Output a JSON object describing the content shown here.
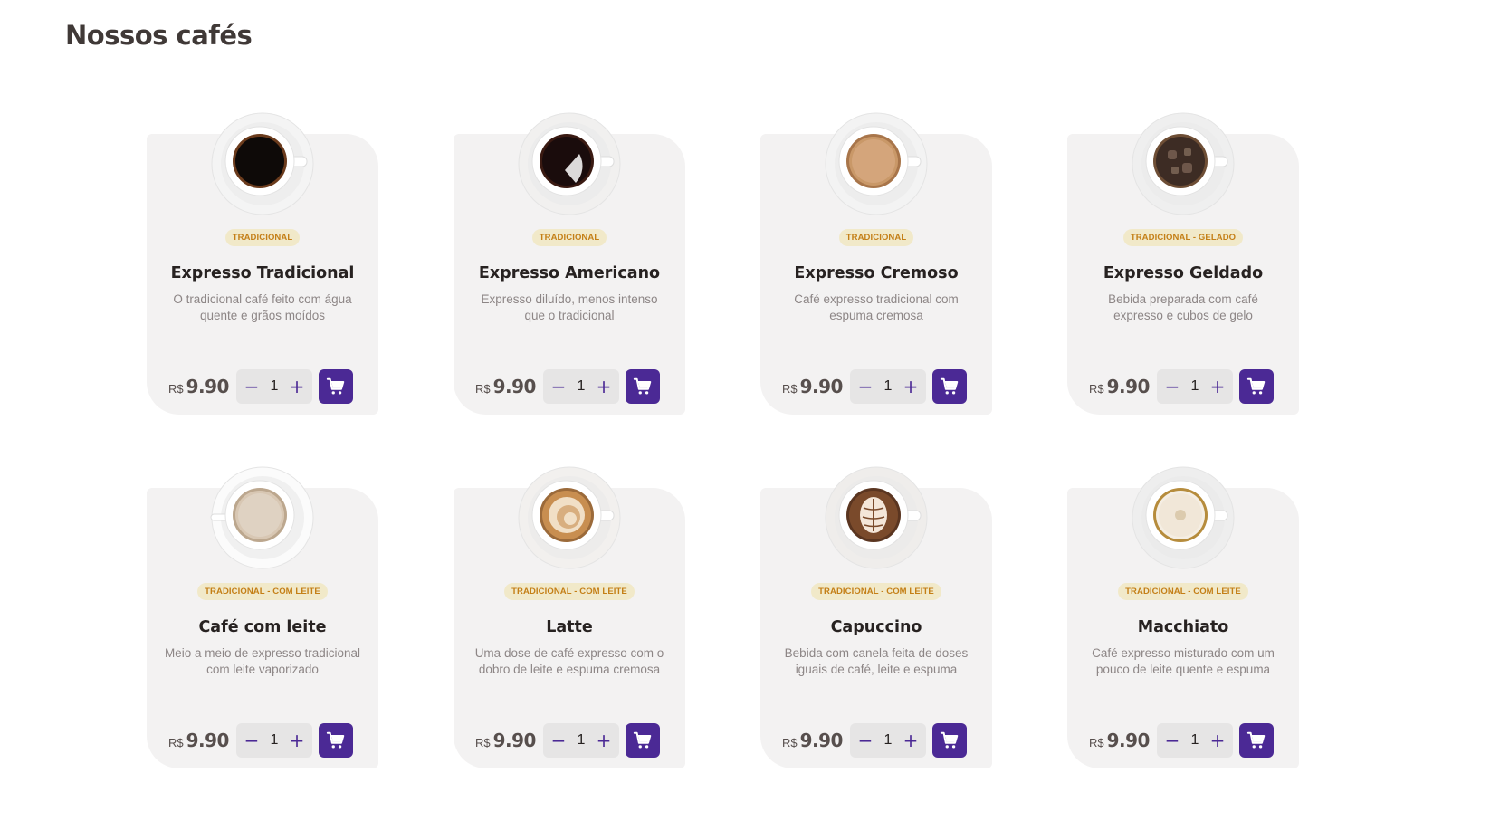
{
  "section": {
    "title": "Nossos cafés"
  },
  "colors": {
    "accent": "#4b2995",
    "tag_bg": "#f1e9c9",
    "tag_text": "#c47f17",
    "card_bg": "#f3f2f2"
  },
  "icons": {
    "cart": "shopping-cart-icon",
    "minus": "minus-icon",
    "plus": "plus-icon"
  },
  "products": [
    {
      "tag": "TRADICIONAL",
      "name": "Expresso Tradicional",
      "description": "O tradicional café feito com água quente e grãos moídos",
      "currency": "R$",
      "price": "9.90",
      "quantity": "1",
      "cup_style": "espresso"
    },
    {
      "tag": "TRADICIONAL",
      "name": "Expresso Americano",
      "description": "Expresso diluído, menos intenso que o tradicional",
      "currency": "R$",
      "price": "9.90",
      "quantity": "1",
      "cup_style": "americano"
    },
    {
      "tag": "TRADICIONAL",
      "name": "Expresso Cremoso",
      "description": "Café expresso tradicional com espuma cremosa",
      "currency": "R$",
      "price": "9.90",
      "quantity": "1",
      "cup_style": "cremoso"
    },
    {
      "tag": "TRADICIONAL - GELADO",
      "name": "Expresso Geldado",
      "description": "Bebida preparada com café expresso e cubos de gelo",
      "currency": "R$",
      "price": "9.90",
      "quantity": "1",
      "cup_style": "gelado"
    },
    {
      "tag": "TRADICIONAL - COM LEITE",
      "name": "Café com leite",
      "description": "Meio a meio de expresso tradicional com leite vaporizado",
      "currency": "R$",
      "price": "9.90",
      "quantity": "1",
      "cup_style": "cafe-leite"
    },
    {
      "tag": "TRADICIONAL - COM LEITE",
      "name": "Latte",
      "description": "Uma dose de café expresso com o dobro de leite e espuma cremosa",
      "currency": "R$",
      "price": "9.90",
      "quantity": "1",
      "cup_style": "latte"
    },
    {
      "tag": "TRADICIONAL - COM LEITE",
      "name": "Capuccino",
      "description": "Bebida com canela feita de doses iguais de café, leite e espuma",
      "currency": "R$",
      "price": "9.90",
      "quantity": "1",
      "cup_style": "capuccino"
    },
    {
      "tag": "TRADICIONAL - COM LEITE",
      "name": "Macchiato",
      "description": "Café expresso misturado com um pouco de leite quente e espuma",
      "currency": "R$",
      "price": "9.90",
      "quantity": "1",
      "cup_style": "macchiato"
    }
  ]
}
